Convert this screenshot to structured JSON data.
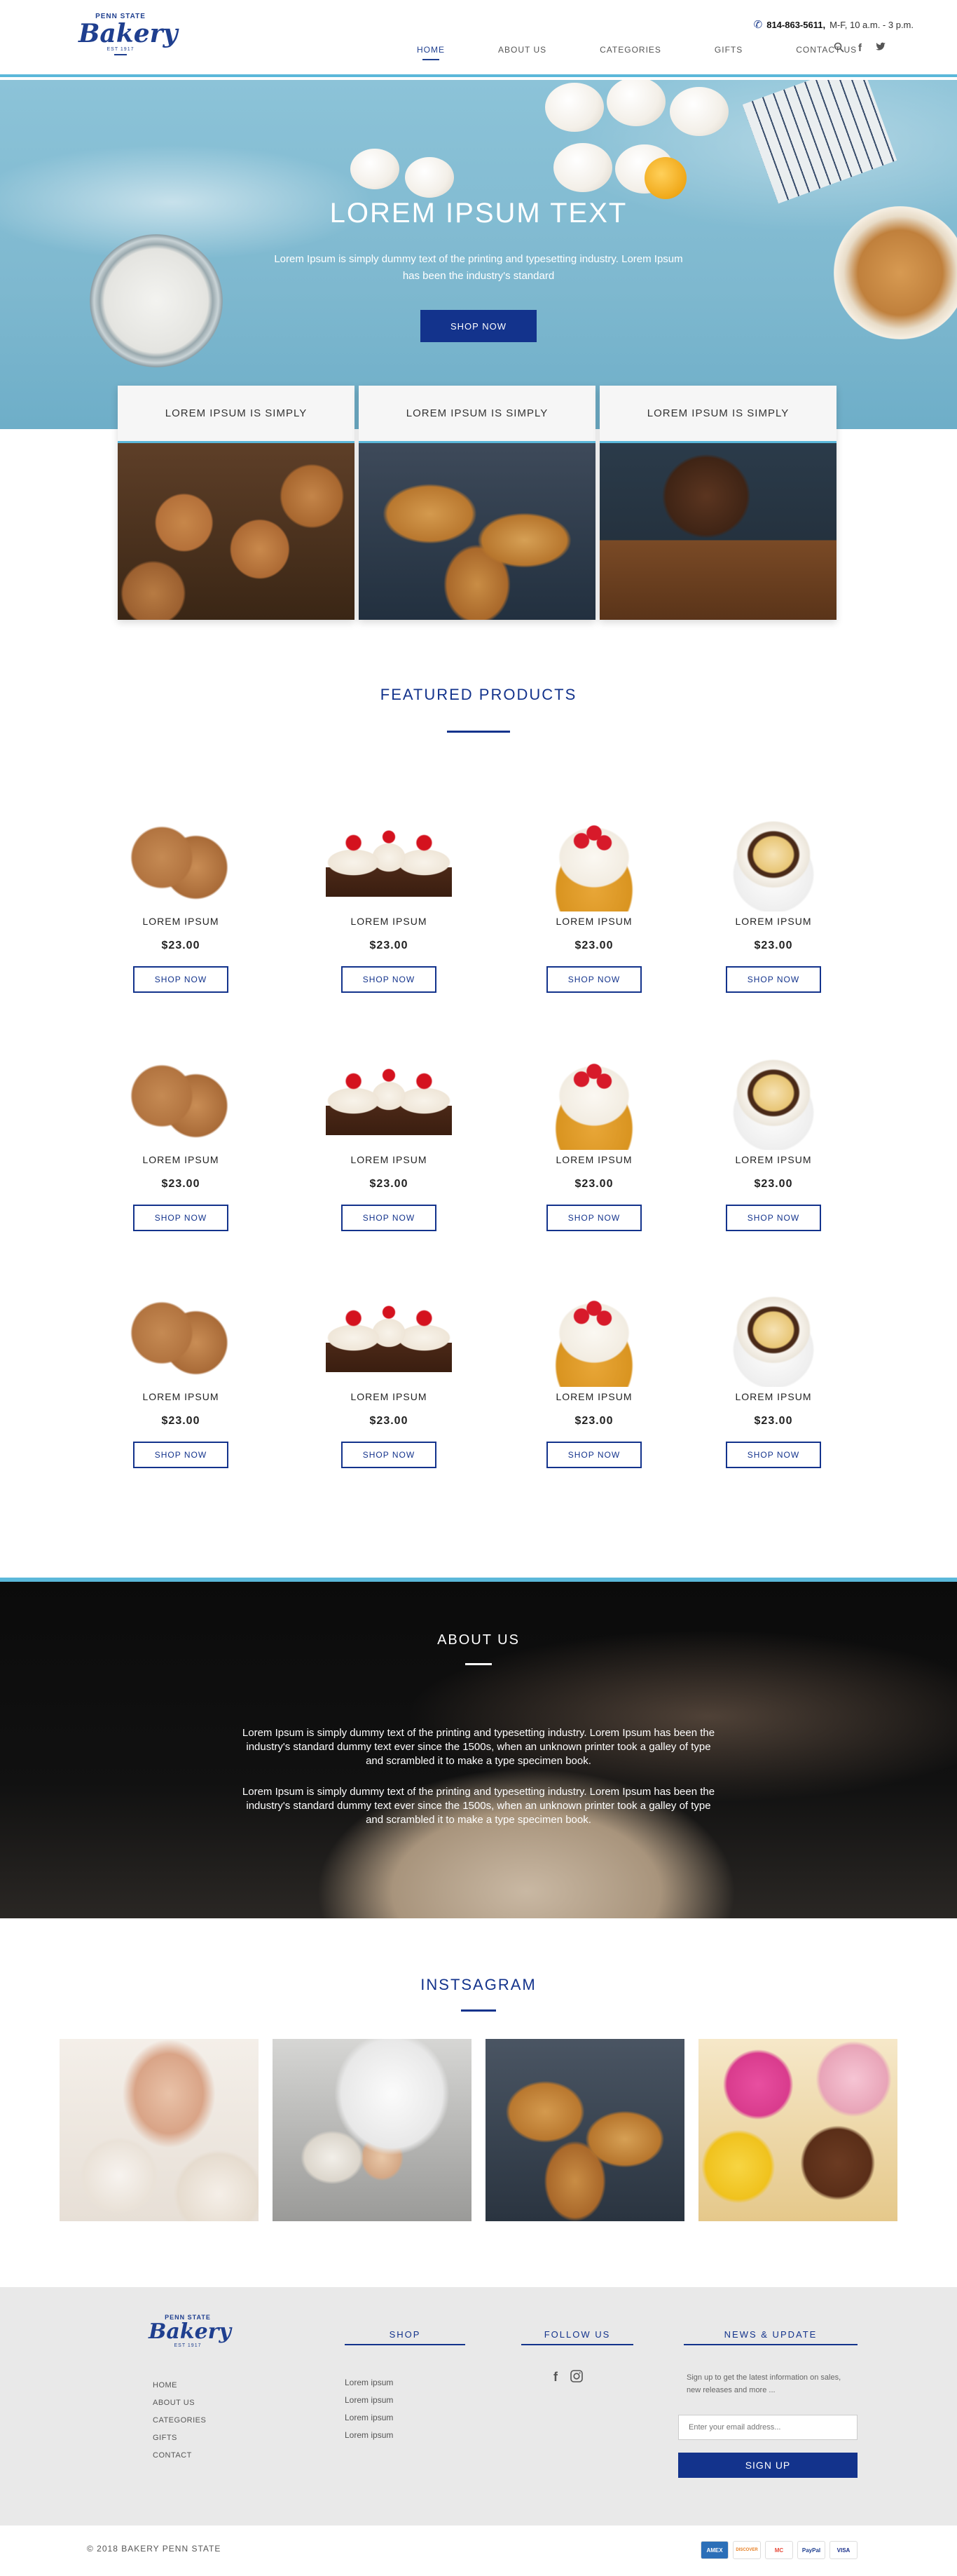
{
  "header": {
    "logo": {
      "top": "PENN STATE",
      "name": "Bakery",
      "est": "EST 1917"
    },
    "phone": "814-863-5611,",
    "hours": "M-F, 10 a.m. - 3 p.m.",
    "nav": [
      "HOME",
      "ABOUT US",
      "CATEGORIES",
      "GIFTS",
      "CONTACT US"
    ],
    "icons": [
      "search-icon",
      "facebook-icon",
      "twitter-icon"
    ]
  },
  "hero": {
    "title": "LOREM IPSUM TEXT",
    "subtitle": "Lorem Ipsum is simply dummy text of the printing and typesetting industry. Lorem Ipsum has been the industry's standard",
    "button": "SHOP NOW"
  },
  "features": [
    {
      "title": "LOREM IPSUM IS SIMPLY",
      "image": "cookies"
    },
    {
      "title": "LOREM IPSUM IS SIMPLY",
      "image": "croissants"
    },
    {
      "title": "LOREM IPSUM IS SIMPLY",
      "image": "cupcake"
    }
  ],
  "featured": {
    "title": "FEATURED PRODUCTS",
    "products": [
      {
        "name": "LOREM IPSUM",
        "price": "$23.00",
        "button": "SHOP NOW",
        "image": "cookies"
      },
      {
        "name": "LOREM IPSUM",
        "price": "$23.00",
        "button": "SHOP NOW",
        "image": "cupcakes"
      },
      {
        "name": "LOREM IPSUM",
        "price": "$23.00",
        "button": "SHOP NOW",
        "image": "strawberry-cake"
      },
      {
        "name": "LOREM IPSUM",
        "price": "$23.00",
        "button": "SHOP NOW",
        "image": "birthday-cake"
      },
      {
        "name": "LOREM IPSUM",
        "price": "$23.00",
        "button": "SHOP NOW",
        "image": "cookies"
      },
      {
        "name": "LOREM IPSUM",
        "price": "$23.00",
        "button": "SHOP NOW",
        "image": "cupcakes"
      },
      {
        "name": "LOREM IPSUM",
        "price": "$23.00",
        "button": "SHOP NOW",
        "image": "strawberry-cake"
      },
      {
        "name": "LOREM IPSUM",
        "price": "$23.00",
        "button": "SHOP NOW",
        "image": "birthday-cake"
      },
      {
        "name": "LOREM IPSUM",
        "price": "$23.00",
        "button": "SHOP NOW",
        "image": "cookies"
      },
      {
        "name": "LOREM IPSUM",
        "price": "$23.00",
        "button": "SHOP NOW",
        "image": "cupcakes"
      },
      {
        "name": "LOREM IPSUM",
        "price": "$23.00",
        "button": "SHOP NOW",
        "image": "strawberry-cake"
      },
      {
        "name": "LOREM IPSUM",
        "price": "$23.00",
        "button": "SHOP NOW",
        "image": "birthday-cake"
      }
    ]
  },
  "about": {
    "title": "ABOUT US",
    "p1": "Lorem Ipsum is simply dummy text of the printing and typesetting industry. Lorem Ipsum has been the industry's standard dummy text ever since the 1500s, when an unknown printer took a galley of type and scrambled it to make a type specimen book.",
    "p2": "Lorem Ipsum is simply dummy text of the printing and typesetting industry. Lorem Ipsum has been the industry's standard dummy text ever since the 1500s, when an unknown printer took a galley of type and scrambled it to make a type specimen book."
  },
  "instagram": {
    "title": "INSTSAGRAM",
    "images": [
      "piping-cupcakes",
      "chef-dough",
      "croissants",
      "colorful-cupcakes"
    ]
  },
  "footer": {
    "links": [
      "HOME",
      "ABOUT US",
      "CATEGORIES",
      "GIFTS",
      "CONTACT"
    ],
    "shop": {
      "title": "SHOP",
      "links": [
        "Lorem ipsum",
        "Lorem ipsum",
        "Lorem ipsum",
        "Lorem ipsum"
      ]
    },
    "follow": {
      "title": "FOLLOW US",
      "icons": [
        "facebook-icon",
        "instagram-icon"
      ]
    },
    "news": {
      "title": "NEWS & UPDATE",
      "text": "Sign up to get the latest information on sales, new releases and more ...",
      "placeholder": "Enter your email address...",
      "button": "SIGN UP"
    },
    "copyright": "© 2018 BAKERY PENN STATE",
    "payments": [
      "AMEX",
      "DISCOVER",
      "MC",
      "PayPal",
      "VISA"
    ]
  },
  "colors": {
    "brand": "#13338c",
    "accent": "#5bb8da",
    "footer": "#e9e9e9"
  }
}
